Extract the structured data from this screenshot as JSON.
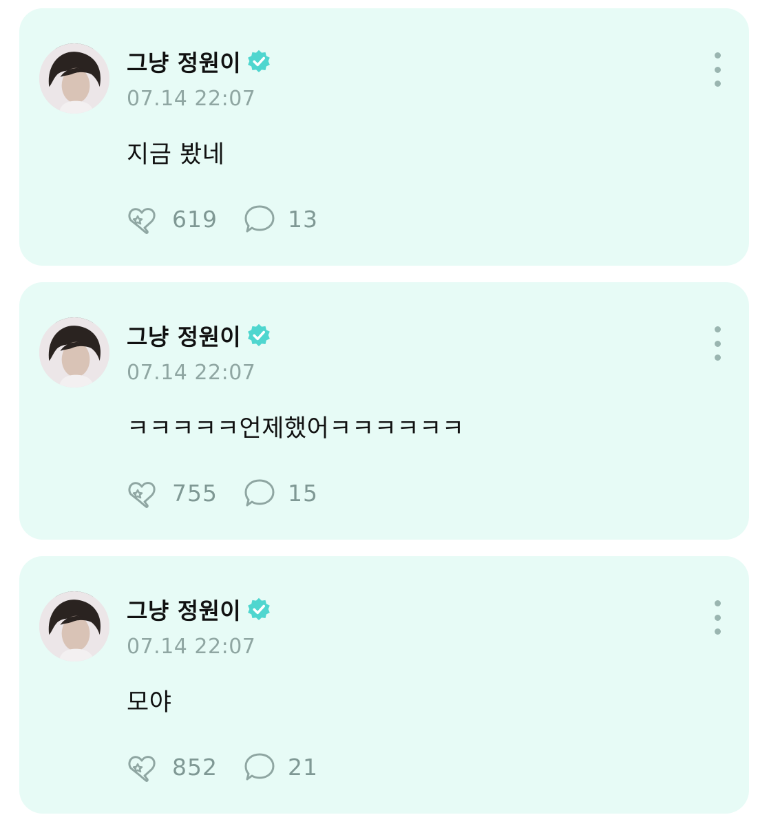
{
  "colors": {
    "card_bg": "#e7fbf6",
    "muted": "#8fa6a2",
    "verified": "#4fd6cf",
    "text": "#111111"
  },
  "posts": [
    {
      "author": "그냥 정원이",
      "timestamp": "07.14 22:07",
      "text": "지금 봤네",
      "likes": "619",
      "comments": "13"
    },
    {
      "author": "그냥 정원이",
      "timestamp": "07.14 22:07",
      "text": "ㅋㅋㅋㅋㅋ언제했어ㅋㅋㅋㅋㅋㅋ",
      "likes": "755",
      "comments": "15"
    },
    {
      "author": "그냥 정원이",
      "timestamp": "07.14 22:07",
      "text": "모야",
      "likes": "852",
      "comments": "21"
    }
  ],
  "icons": {
    "verified": "verified-badge-icon",
    "more": "more-vertical-icon",
    "like": "star-heart-icon",
    "comment": "comment-bubble-icon"
  }
}
